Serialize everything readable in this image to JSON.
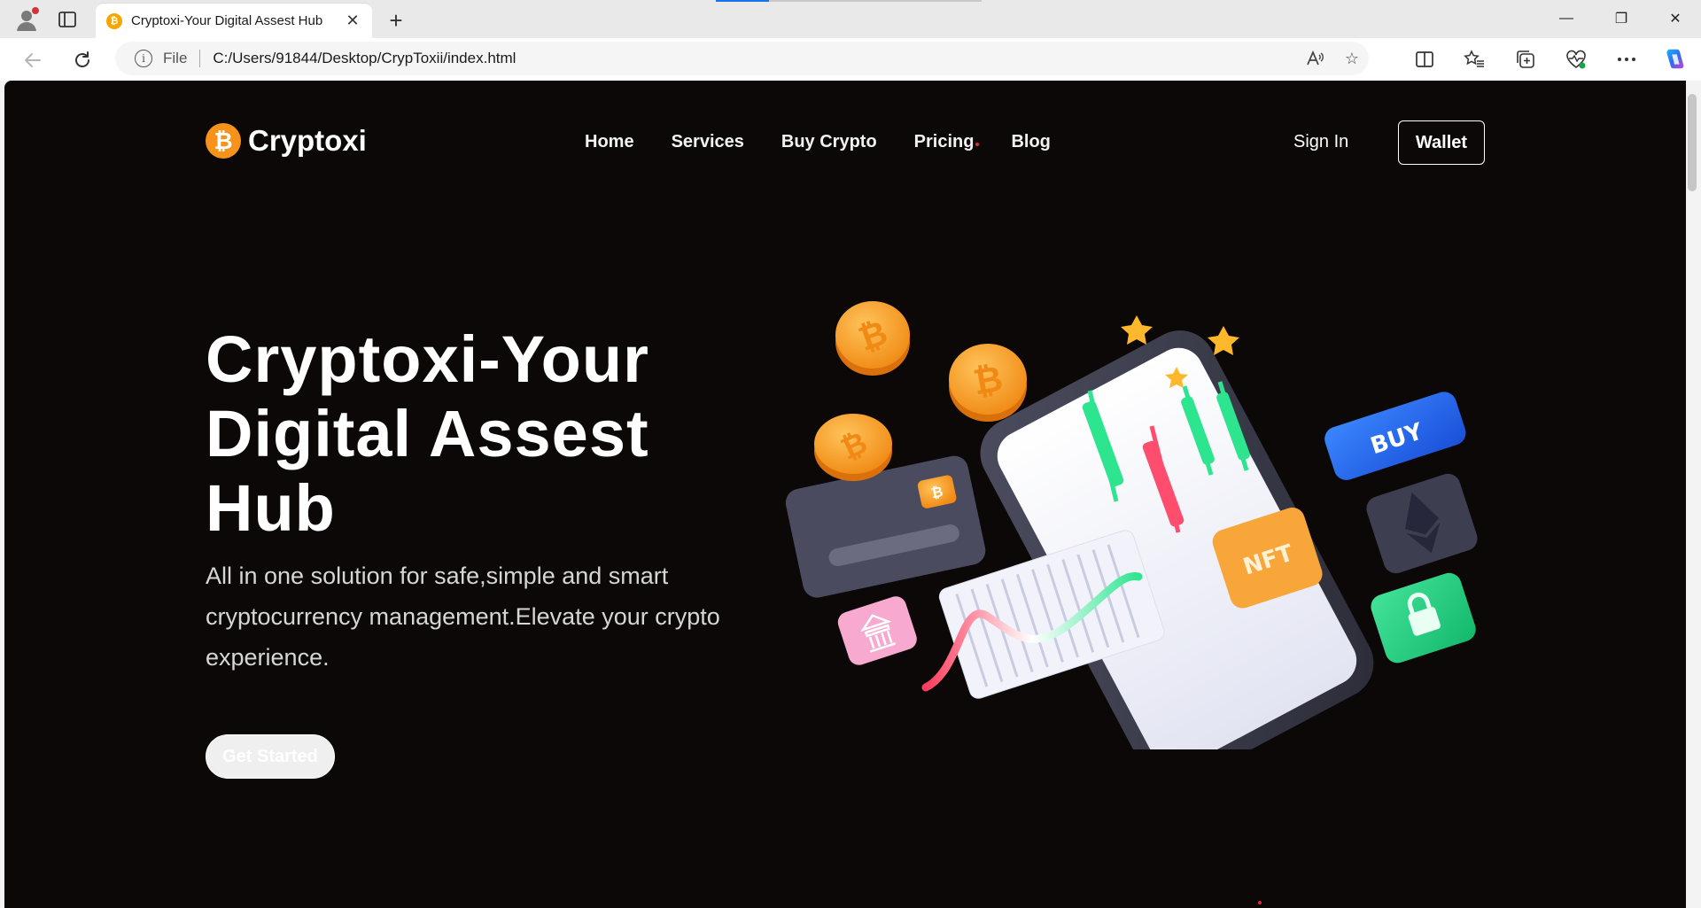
{
  "browser": {
    "tab_title": "Cryptoxi-Your Digital Assest Hub",
    "favicon_glyph": "₿",
    "new_tab": "+",
    "close_glyph": "✕",
    "address": {
      "scheme": "File",
      "url": "C:/Users/91844/Desktop/CrypToxii/index.html",
      "read_aloud": "A",
      "favorite": "☆"
    },
    "window_controls": {
      "minimize": "—",
      "restore": "❐",
      "close": "✕"
    },
    "toolbar_icons": [
      "split-screen-icon",
      "favorites-icon",
      "collections-icon",
      "browser-essentials-icon",
      "more-icon",
      "copilot-icon"
    ]
  },
  "site": {
    "logo": {
      "glyph": "₿",
      "name": "Cryptoxi"
    },
    "nav": [
      "Home",
      "Services",
      "Buy Crypto",
      "Pricing",
      "Blog"
    ],
    "sign_in": "Sign In",
    "wallet": "Wallet",
    "hero": {
      "title": "Cryptoxi-Your Digital Assest Hub",
      "subtitle": "All in one solution for safe,simple and smart cryptocurrency management.Elevate your crypto experience.",
      "cta": "Get Started"
    },
    "illustration": {
      "buy_label": "BUY",
      "nft_label": "NFT",
      "coin_glyph": "₿"
    },
    "colors": {
      "background": "#0c0807",
      "bitcoin_orange": "#f7931a",
      "accent_red": "#e5243a",
      "candle_green": "#3ddc84",
      "candle_red": "#ff4d6d",
      "buy_blue": "#1e63e9"
    }
  }
}
